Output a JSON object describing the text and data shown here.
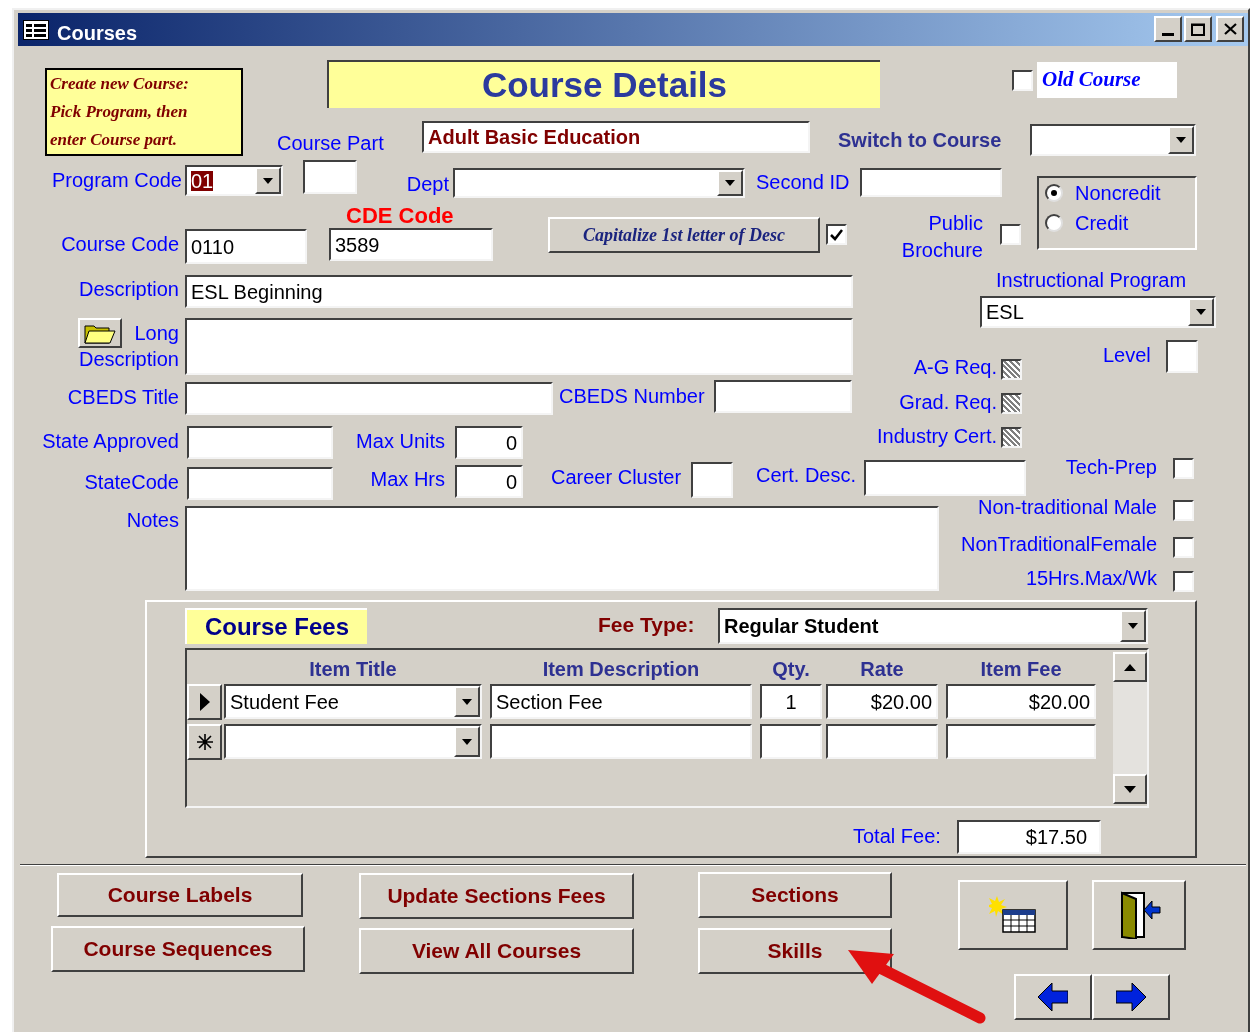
{
  "window": {
    "title": "Courses"
  },
  "instructions": [
    "Create new Course:",
    "Pick Program, then",
    "enter Course part."
  ],
  "title": "Course Details",
  "old_course": {
    "label": "Old Course",
    "checked": false
  },
  "program_name": "Adult Basic Education",
  "switch_to_course": {
    "label": "Switch to Course"
  },
  "course_part": {
    "label": "Course Part"
  },
  "program_code": {
    "label": "Program Code",
    "value": "01"
  },
  "dept": {
    "label": "Dept"
  },
  "second_id": {
    "label": "Second ID"
  },
  "credit_type": [
    {
      "label": "Noncredit",
      "selected": true
    },
    {
      "label": "Credit",
      "selected": false
    }
  ],
  "cde_code": {
    "label": "CDE Code",
    "value": "3589"
  },
  "course_code": {
    "label": "Course Code",
    "value": "0110"
  },
  "capitalize": {
    "label": "Capitalize 1st letter of Desc",
    "checked": true
  },
  "public_brochure": {
    "label": "Public Brochure",
    "checked": false
  },
  "description": {
    "label": "Description",
    "value": "ESL Beginning"
  },
  "long_description": {
    "label_lines": [
      "Long",
      "Description"
    ]
  },
  "instructional_program": {
    "label": "Instructional Program",
    "value": "ESL"
  },
  "level": {
    "label": "Level"
  },
  "cbeds_title": {
    "label": "CBEDS Title"
  },
  "cbeds_number": {
    "label": "CBEDS Number"
  },
  "requirements": [
    {
      "label": "A-G Req.",
      "indeterminate": true
    },
    {
      "label": "Grad. Req.",
      "indeterminate": true
    },
    {
      "label": "Industry Cert.",
      "indeterminate": true
    }
  ],
  "state_approved": {
    "label": "State Approved"
  },
  "max_units": {
    "label": "Max Units",
    "value": "0"
  },
  "state_code": {
    "label": "StateCode"
  },
  "max_hrs": {
    "label": "Max Hrs",
    "value": "0"
  },
  "career_cluster": {
    "label": "Career Cluster"
  },
  "cert_desc": {
    "label": "Cert. Desc."
  },
  "flags": [
    {
      "label": "Tech-Prep",
      "checked": false
    },
    {
      "label": "Non-traditional Male",
      "checked": false
    },
    {
      "label": "NonTraditionalFemale",
      "checked": false
    },
    {
      "label": "15Hrs.Max/Wk",
      "checked": false
    }
  ],
  "notes": {
    "label": "Notes"
  },
  "fees": {
    "title": "Course Fees",
    "fee_type_label": "Fee Type:",
    "fee_type": "Regular Student",
    "columns": [
      "Item Title",
      "Item Description",
      "Qty.",
      "Rate",
      "Item Fee"
    ],
    "rows": [
      {
        "kind": "current",
        "cells": [
          "Student Fee",
          "Section Fee",
          "1",
          "$20.00",
          "$20.00"
        ]
      },
      {
        "kind": "new"
      }
    ],
    "total_label": "Total Fee:",
    "total": "$17.50"
  },
  "buttons": [
    {
      "label": "Course Labels"
    },
    {
      "label": "Course Sequences"
    },
    {
      "label": "Update Sections Fees"
    },
    {
      "label": "View All Courses"
    },
    {
      "label": "Sections"
    },
    {
      "label": "Skills"
    }
  ]
}
